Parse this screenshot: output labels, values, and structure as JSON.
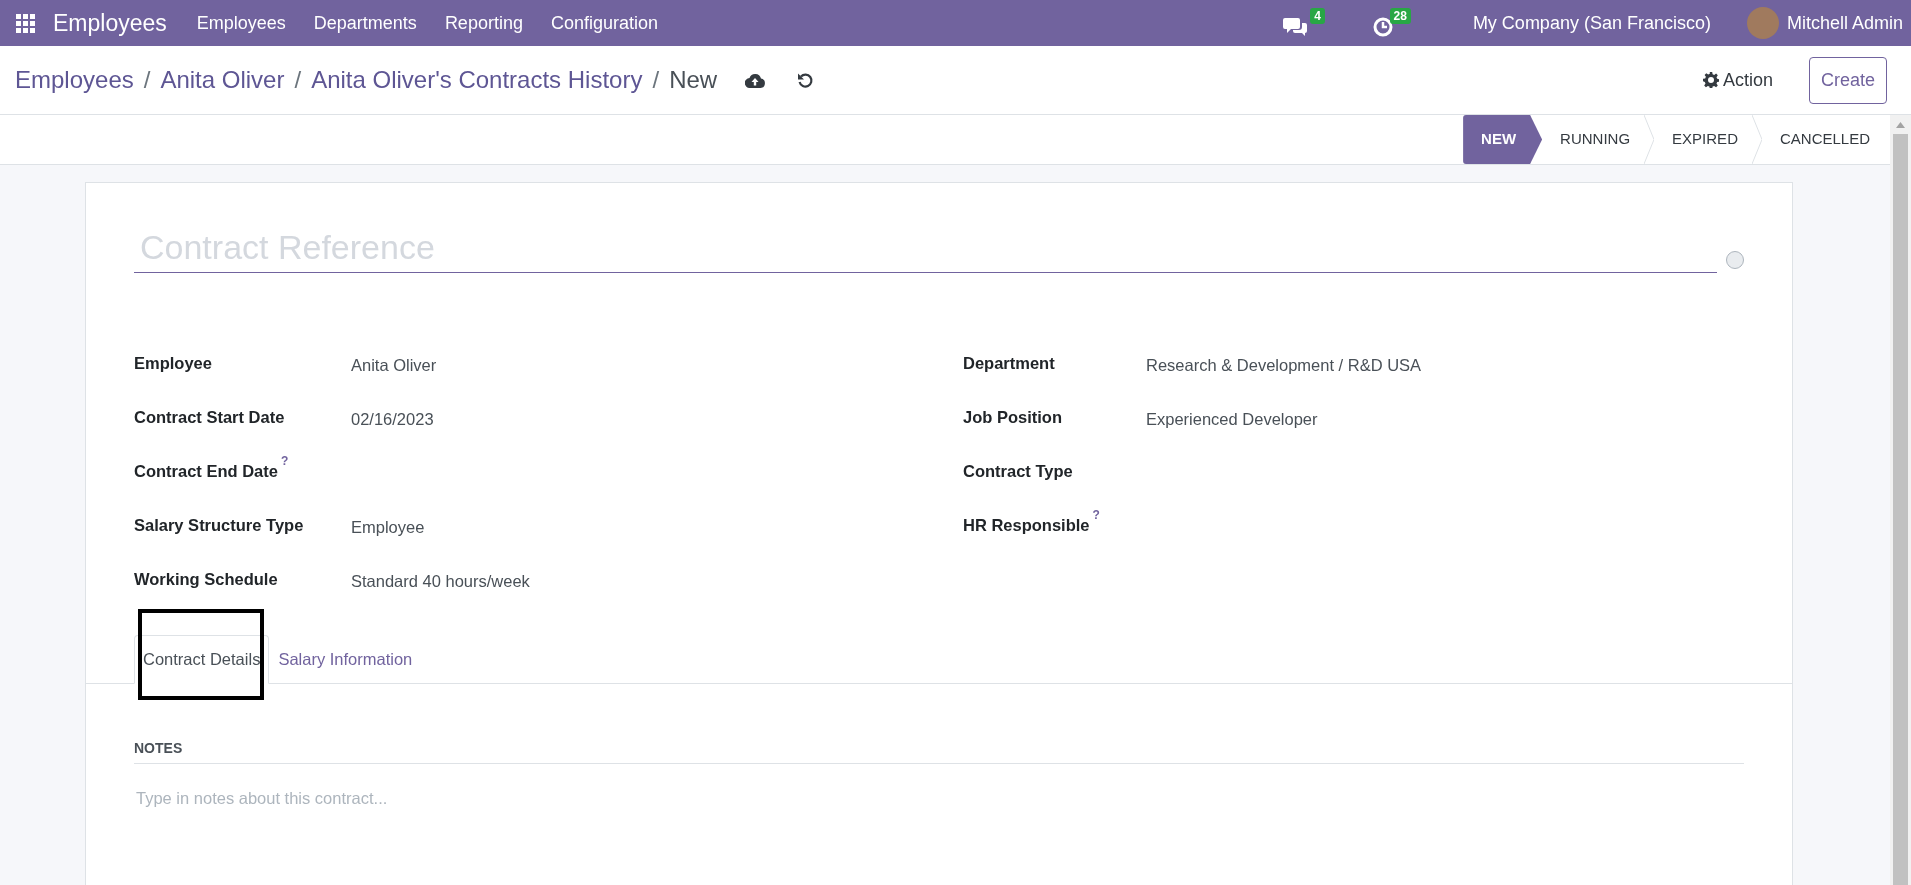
{
  "navbar": {
    "app_name": "Employees",
    "menu": [
      "Employees",
      "Departments",
      "Reporting",
      "Configuration"
    ],
    "messages_count": "4",
    "activities_count": "28",
    "company": "My Company (San Francisco)",
    "user": "Mitchell Admin"
  },
  "breadcrumbs": [
    {
      "label": "Employees",
      "current": false
    },
    {
      "label": "Anita Oliver",
      "current": false
    },
    {
      "label": "Anita Oliver's Contracts History",
      "current": false
    },
    {
      "label": "New",
      "current": true
    }
  ],
  "breadcrumb_separator": "/",
  "actions": {
    "action": "Action",
    "create": "Create"
  },
  "stages": [
    {
      "label": "NEW",
      "selected": true
    },
    {
      "label": "RUNNING",
      "selected": false
    },
    {
      "label": "EXPIRED",
      "selected": false
    },
    {
      "label": "CANCELLED",
      "selected": false
    }
  ],
  "form": {
    "title_placeholder": "Contract Reference",
    "left_fields": [
      {
        "label": "Employee",
        "value": "Anita Oliver"
      },
      {
        "label": "Contract Start Date",
        "value": "02/16/2023"
      },
      {
        "label": "Contract End Date",
        "help_mark": "?"
      },
      {
        "label": "Salary Structure Type",
        "value": "Employee"
      },
      {
        "label": "Working Schedule",
        "value": "Standard 40 hours/week"
      }
    ],
    "right_fields": [
      {
        "label": "Department",
        "value": "Research & Development / R&D USA"
      },
      {
        "label": "Job Position",
        "value": "Experienced Developer"
      },
      {
        "label": "Contract Type"
      },
      {
        "label": "HR Responsible",
        "help_mark": "?"
      }
    ]
  },
  "tabs": [
    {
      "label": "Contract Details",
      "selected": true,
      "highlighted": true
    },
    {
      "label": "Salary Information",
      "selected": false,
      "highlighted": false
    }
  ],
  "notes": {
    "heading": "NOTES",
    "placeholder": "Type in notes about this contract..."
  }
}
